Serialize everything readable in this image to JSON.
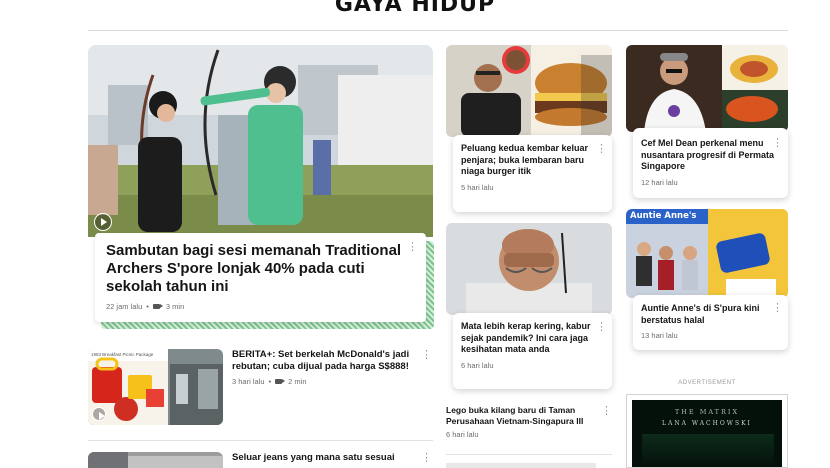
{
  "section": {
    "title": "GAYA HIDUP"
  },
  "hero": {
    "title": "Sambutan bagi sesi memanah Traditional Archers S'pore lonjak 40% pada cuti sekolah tahun ini",
    "time": "22 jam lalu",
    "read": "3 min"
  },
  "col2": [
    {
      "title": "Peluang kedua kembar keluar penjara; buka lembaran baru niaga burger itik",
      "time": "5 hari lalu"
    },
    {
      "title": "Mata lebih kerap kering, kabur sejak pandemik? Ini cara jaga kesihatan mata anda",
      "time": "6 hari lalu"
    },
    {
      "title": "Lego buka kilang baru di Taman Perusahaan Vietnam-Singapura III",
      "time": "6 hari lalu"
    }
  ],
  "col3": [
    {
      "title": "Cef Mel Dean perkenal menu nusantara progresif di Permata Singapore",
      "time": "12 hari lalu"
    },
    {
      "title": "Auntie Anne's di S'pura kini berstatus halal",
      "time": "13 hari lalu"
    }
  ],
  "list": [
    {
      "title": "BERITA+: Set berkelah McDonald's jadi rebutan; cuba dijual pada harga S$888!",
      "time": "3 hari lalu",
      "read": "2 min",
      "image_text": "1983 Breakfast Picnic Package"
    },
    {
      "title": "Seluar jeans yang mana satu sesuai"
    }
  ],
  "ad": {
    "label": "ADVERTISEMENT",
    "line1": "THE MATRIX",
    "line2": "LANA WACHOWSKI"
  },
  "store_sign": "Auntie Anne's",
  "colors": {
    "accent_green": "#7cc48f",
    "text": "#151515",
    "meta": "#6b6b6b"
  }
}
